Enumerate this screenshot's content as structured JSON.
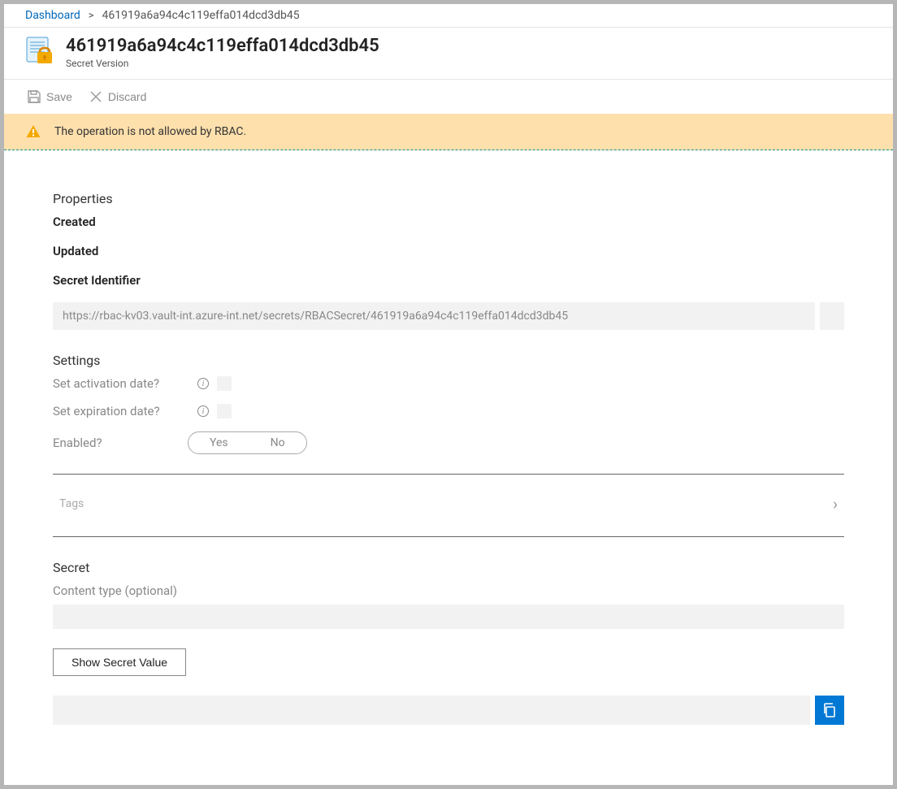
{
  "breadcrumb": {
    "root": "Dashboard",
    "current": "461919a6a94c4c119effa014dcd3db45"
  },
  "title": {
    "heading": "461919a6a94c4c119effa014dcd3db45",
    "subtitle": "Secret Version"
  },
  "toolbar": {
    "save_label": "Save",
    "discard_label": "Discard"
  },
  "alert": {
    "message": "The operation is not allowed by RBAC."
  },
  "properties": {
    "heading": "Properties",
    "created_label": "Created",
    "updated_label": "Updated",
    "secret_id_label": "Secret Identifier",
    "secret_id_value": "https://rbac-kv03.vault-int.azure-int.net/secrets/RBACSecret/461919a6a94c4c119effa014dcd3db45"
  },
  "settings": {
    "heading": "Settings",
    "activation_label": "Set activation date?",
    "expiration_label": "Set expiration date?",
    "enabled_label": "Enabled?",
    "yes": "Yes",
    "no": "No",
    "tags_label": "Tags"
  },
  "secret": {
    "heading": "Secret",
    "content_type_label": "Content type (optional)",
    "show_button": "Show Secret Value"
  }
}
